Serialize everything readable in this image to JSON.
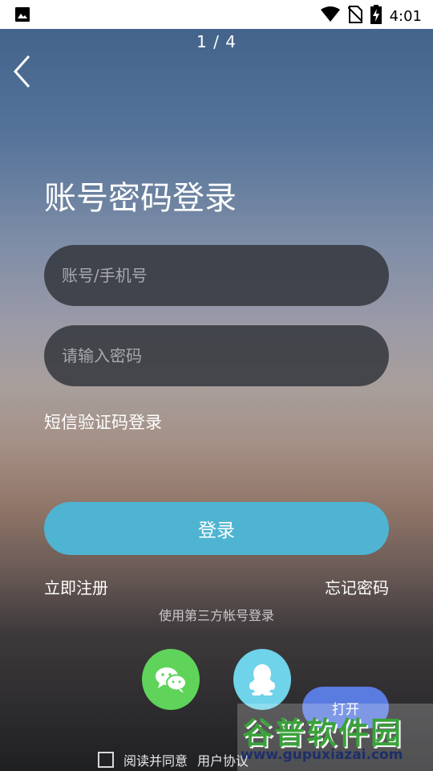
{
  "status_bar": {
    "time": "4:01",
    "icons": [
      "image-icon",
      "wifi-icon",
      "no-sim-icon",
      "battery-charging-icon"
    ]
  },
  "page_indicator": "1 / 4",
  "header": {
    "back_icon": "back-chevron-icon"
  },
  "title": "账号密码登录",
  "form": {
    "account_placeholder": "账号/手机号",
    "account_value": "",
    "password_placeholder": "请输入密码",
    "password_value": ""
  },
  "sms_login_label": "短信验证码登录",
  "login_button_label": "登录",
  "register_label": "立即注册",
  "forgot_label": "忘记密码",
  "third_party_label": "使用第三方帐号登录",
  "social": [
    {
      "name": "wechat",
      "icon": "wechat-icon",
      "color": "#5fd35a"
    },
    {
      "name": "qq",
      "icon": "qq-penguin-icon",
      "color": "#6fd3ea"
    }
  ],
  "open_button_label": "打开",
  "agreement": {
    "read_agree": "阅读并同意",
    "user_agreement": "用户协议"
  },
  "watermark": {
    "brand": "谷普软件园",
    "url": "www.gupuxiazai.com"
  },
  "colors": {
    "accent": "#4fb4d2",
    "field_bg": "#303238",
    "wechat": "#5fd35a",
    "qq": "#6fd3ea",
    "open_button": "#5a7bdf"
  }
}
